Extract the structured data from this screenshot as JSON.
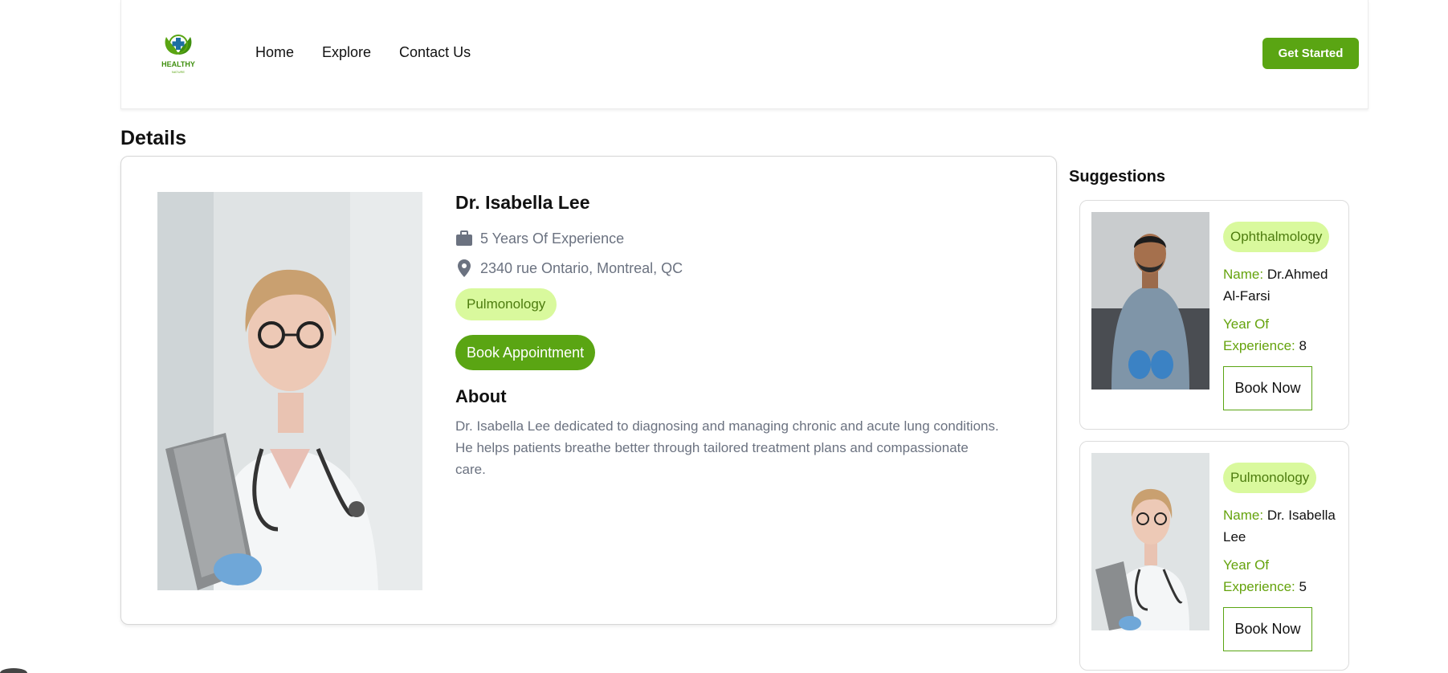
{
  "brand": {
    "logo_text": "HEALTHY",
    "logo_subtext": "NATURE",
    "accent": "#5aa513",
    "pill_bg": "#d9f99d"
  },
  "nav": {
    "links": [
      "Home",
      "Explore",
      "Contact Us"
    ],
    "cta_label": "Get Started"
  },
  "details": {
    "heading": "Details",
    "doctor_name": "Dr. Isabella Lee",
    "experience": "5 Years Of Experience",
    "address": "2340 rue Ontario, Montreal, QC",
    "specialty": "Pulmonology",
    "book_label": "Book Appointment",
    "about_heading": "About",
    "about_text": "Dr. Isabella Lee dedicated to diagnosing and managing chronic and acute lung conditions. He helps patients breathe better through tailored treatment plans and compassionate care.",
    "experience_icon": "briefcase-icon",
    "address_icon": "map-pin-icon"
  },
  "suggestions": {
    "heading": "Suggestions",
    "name_label": "Name:",
    "experience_label": "Year Of Experience:",
    "book_label": "Book Now",
    "items": [
      {
        "specialty": "Ophthalmology",
        "name": "Dr.Ahmed Al-Farsi",
        "years": "8"
      },
      {
        "specialty": "Pulmonology",
        "name": "Dr. Isabella Lee",
        "years": "5"
      }
    ]
  }
}
